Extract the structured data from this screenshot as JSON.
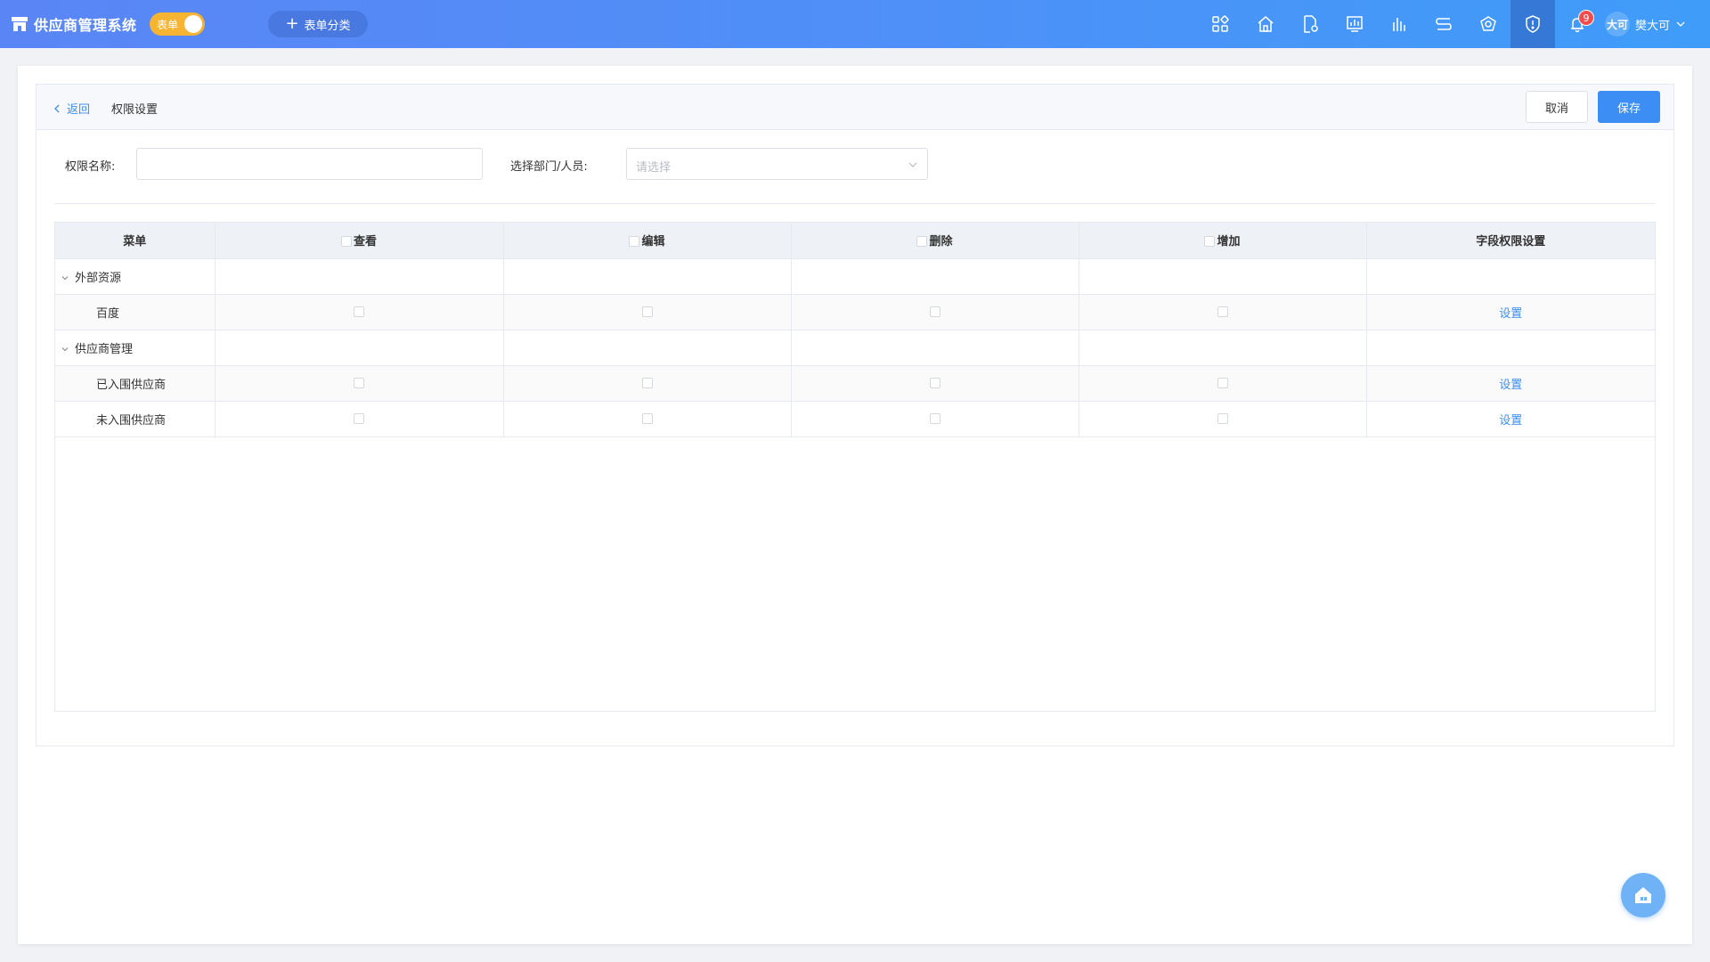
{
  "app": {
    "title": "供应商管理系统",
    "toggle_label": "表单",
    "category_button": "表单分类",
    "nav_icons": [
      "apps-icon",
      "home-icon",
      "document-settings-icon",
      "dashboard-icon",
      "chart-icon",
      "flow-icon",
      "robot-icon",
      "shield-icon",
      "bell-icon"
    ],
    "notification_count": "9",
    "user": {
      "avatar_text": "大可",
      "name": "樊大可"
    }
  },
  "header": {
    "back_label": "返回",
    "title": "权限设置",
    "cancel_label": "取消",
    "save_label": "保存"
  },
  "form": {
    "name_label": "权限名称:",
    "name_value": "",
    "dept_label": "选择部门/人员:",
    "dept_placeholder": "请选择"
  },
  "table": {
    "columns": [
      "菜单",
      "查看",
      "编辑",
      "删除",
      "增加",
      "字段权限设置"
    ],
    "groups": [
      {
        "name": "外部资源",
        "items": [
          {
            "name": "百度",
            "action": "设置"
          }
        ]
      },
      {
        "name": "供应商管理",
        "items": [
          {
            "name": "已入围供应商",
            "action": "设置"
          },
          {
            "name": "未入围供应商",
            "action": "设置"
          }
        ]
      }
    ]
  },
  "colors": {
    "accent": "#3c8ef5",
    "topbar_start": "#5a86f5",
    "topbar_end": "#3f9cf9",
    "toggle": "#f7b432",
    "badge": "#f24d4d"
  }
}
